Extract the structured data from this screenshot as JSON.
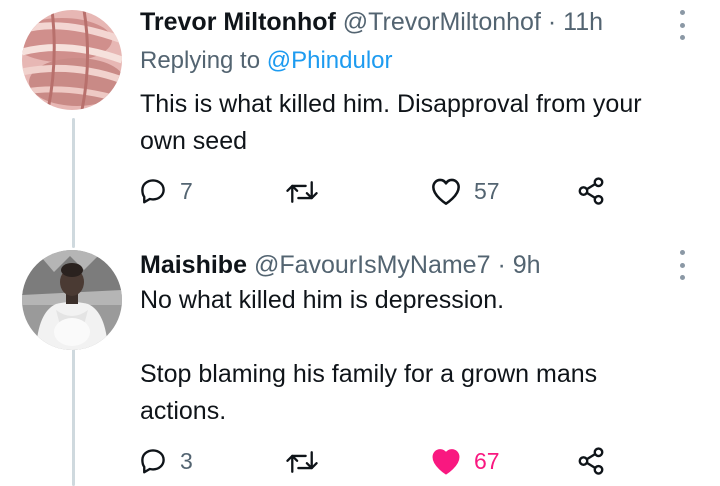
{
  "tweets": [
    {
      "display_name": "Trevor Miltonhof",
      "handle": "@TrevorMiltonhof",
      "separator": "·",
      "time": "11h",
      "replying_label": "Replying to",
      "replying_to": "@Phindulor",
      "text_lines": [
        "This is what killed him. Disapproval from your",
        "own seed"
      ],
      "replies": "7",
      "likes": "57",
      "liked": false,
      "avatar_icon": "hands-photo"
    },
    {
      "display_name": "Maishibe",
      "handle": "@FavourIsMyName7",
      "separator": "·",
      "time": "9h",
      "text_lines": [
        "No what killed him is depression.",
        "",
        "Stop blaming his family for a grown mans",
        "actions."
      ],
      "replies": "3",
      "likes": "67",
      "liked": true,
      "avatar_icon": "woman-photo"
    }
  ],
  "colors": {
    "text": "#0f1419",
    "secondary": "#536471",
    "link": "#1d9bf0",
    "like_active": "#f91880",
    "thread_line": "#cfd9de"
  }
}
